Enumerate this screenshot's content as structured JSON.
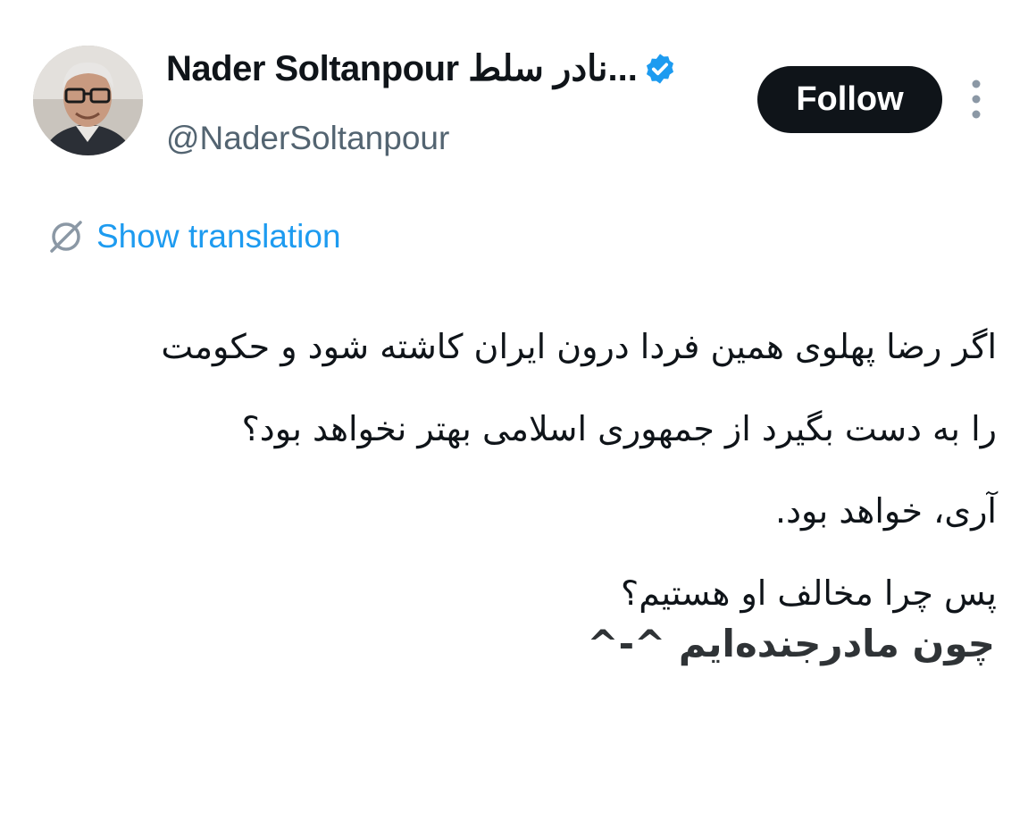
{
  "profile": {
    "display_name": "Nader Soltanpour نادر سلط...",
    "handle": "@NaderSoltanpour",
    "avatar_icon": "profile-photo",
    "verified_icon": "verified-badge-icon",
    "verified_color": "#1d9bf0"
  },
  "actions": {
    "follow_label": "Follow",
    "more_icon": "more-vertical-icon"
  },
  "translation": {
    "icon": "globe-slash-icon",
    "label": "Show translation",
    "color": "#1d9bf0"
  },
  "tweet": {
    "lines": [
      "اگر رضا پهلوی همین فردا درون ایران کاشته شود و حکومت",
      "را به دست بگیرد از جمهوری اسلامی بهتر نخواهد بود؟",
      "آری، خواهد بود.",
      "پس چرا مخالف او هستیم؟"
    ]
  },
  "overlay": {
    "caption": "چون مادرجنده‌ایم ^-^"
  }
}
